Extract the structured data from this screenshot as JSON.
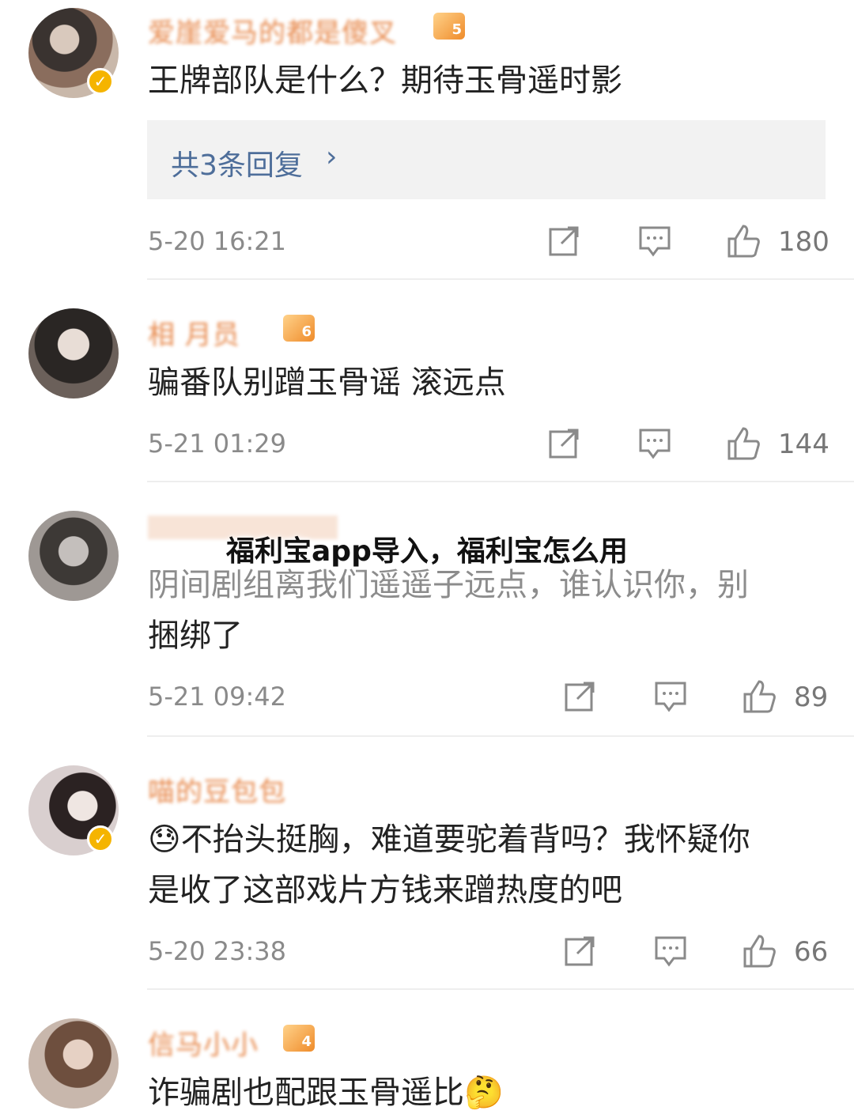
{
  "comments": [
    {
      "username": "爱崖爱马的都是傻叉",
      "level": "5",
      "verified": true,
      "text": "王牌部队是什么？期待玉骨遥时影",
      "replies_label": "共3条回复",
      "time": "5-20 16:21",
      "likes": "180"
    },
    {
      "username": "相   月员",
      "level": "6",
      "verified": false,
      "text": "骗番队别蹭玉骨谣 滚远点",
      "time": "5-21 01:29",
      "likes": "144"
    },
    {
      "username": "",
      "level": "",
      "verified": false,
      "text_line1": "阴间剧组离我们遥遥子远点，谁认识你，别",
      "text_line2": "捆绑了",
      "time": "5-21 09:42",
      "likes": "89"
    },
    {
      "username": "喵的豆包包",
      "level": "",
      "verified": true,
      "emoji": "😓",
      "text_line1": "不抬头挺胸，难道要驼着背吗？我怀疑你",
      "text_line2": "是收了这部戏片方钱来蹭热度的吧",
      "time": "5-20 23:38",
      "likes": "66"
    },
    {
      "username": "信马小小",
      "level": "4",
      "verified": false,
      "text": "诈骗剧也配跟玉骨遥比",
      "emoji": "🤔"
    }
  ],
  "overlay_title": "福利宝app导入，福利宝怎么用",
  "icons": {
    "repost": "repost-icon",
    "comment": "comment-icon",
    "like": "thumbs-up-icon",
    "reply_chevron": "chevron-right-icon",
    "verified": "verified-badge-icon"
  },
  "colors": {
    "username": "#e3742c",
    "reply_link": "#4e6e9a",
    "verified": "#f5b400"
  }
}
